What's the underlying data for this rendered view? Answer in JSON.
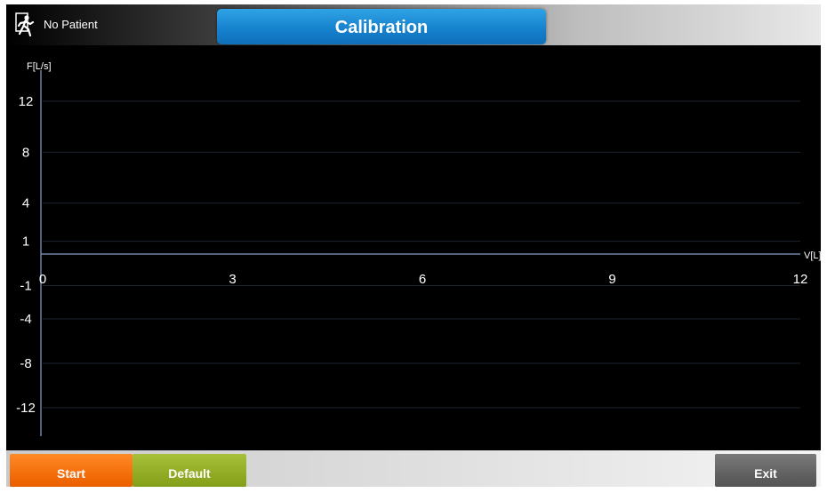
{
  "header": {
    "patient_label": "No Patient",
    "title": "Calibration",
    "patient_icon": "exit-person-icon"
  },
  "chart_data": {
    "type": "line",
    "xlabel": "V[L]",
    "ylabel": "F[L/s]",
    "x_ticks": [
      0,
      3,
      6,
      9,
      12
    ],
    "y_ticks": [
      12,
      8,
      4,
      1,
      -1,
      -4,
      -8,
      -12
    ],
    "xlim": [
      0,
      12
    ],
    "ylim": [
      -12,
      12
    ],
    "grid": true,
    "series": []
  },
  "footer": {
    "start_label": "Start",
    "default_label": "Default",
    "exit_label": "Exit"
  },
  "colors": {
    "title_tab": "#1580cc",
    "start": "#f26a08",
    "default": "#8ea821",
    "exit": "#5e5e5e",
    "axis": "#6f84a8"
  }
}
